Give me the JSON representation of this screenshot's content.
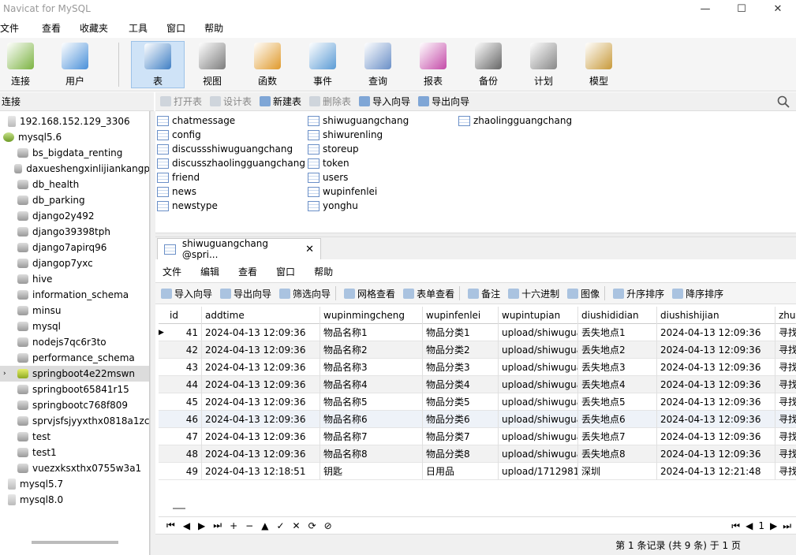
{
  "window": {
    "title": "Navicat for MySQL",
    "controls": [
      "—",
      "☐",
      "✕"
    ]
  },
  "menu": [
    "文件",
    "查看",
    "收藏夹",
    "工具",
    "窗口",
    "帮助"
  ],
  "toolbar": [
    {
      "label": "连接",
      "icon": "connection-icon"
    },
    {
      "label": "用户",
      "icon": "user-icon"
    },
    {
      "label": "表",
      "icon": "table-icon",
      "active": true
    },
    {
      "label": "视图",
      "icon": "view-icon"
    },
    {
      "label": "函数",
      "icon": "function-icon"
    },
    {
      "label": "事件",
      "icon": "event-icon"
    },
    {
      "label": "查询",
      "icon": "query-icon"
    },
    {
      "label": "报表",
      "icon": "report-icon"
    },
    {
      "label": "备份",
      "icon": "backup-icon"
    },
    {
      "label": "计划",
      "icon": "schedule-icon"
    },
    {
      "label": "模型",
      "icon": "model-icon"
    }
  ],
  "left": {
    "header": "连接",
    "tree": [
      {
        "label": "192.168.152.129_3306",
        "type": "server",
        "level": 0
      },
      {
        "label": "mysql5.6",
        "type": "conn",
        "level": 0
      },
      {
        "label": "bs_bigdata_renting",
        "type": "db",
        "level": 1
      },
      {
        "label": "daxueshengxinlijiankangp",
        "type": "db",
        "level": 1
      },
      {
        "label": "db_health",
        "type": "db",
        "level": 1
      },
      {
        "label": "db_parking",
        "type": "db",
        "level": 1
      },
      {
        "label": "django2y492",
        "type": "db",
        "level": 1
      },
      {
        "label": "django39398tph",
        "type": "db",
        "level": 1
      },
      {
        "label": "django7apirq96",
        "type": "db",
        "level": 1
      },
      {
        "label": "djangop7yxc",
        "type": "db",
        "level": 1
      },
      {
        "label": "hive",
        "type": "db",
        "level": 1
      },
      {
        "label": "information_schema",
        "type": "db",
        "level": 1
      },
      {
        "label": "minsu",
        "type": "db",
        "level": 1
      },
      {
        "label": "mysql",
        "type": "db",
        "level": 1
      },
      {
        "label": "nodejs7qc6r3to",
        "type": "db",
        "level": 1
      },
      {
        "label": "performance_schema",
        "type": "db",
        "level": 1
      },
      {
        "label": "springboot4e22mswn",
        "type": "dbopen",
        "level": 1,
        "selected": true
      },
      {
        "label": "springboot65841r15",
        "type": "db",
        "level": 1
      },
      {
        "label": "springbootc768f809",
        "type": "db",
        "level": 1
      },
      {
        "label": "sprvjsfsjyyxthx0818a1zc",
        "type": "db",
        "level": 1
      },
      {
        "label": "test",
        "type": "db",
        "level": 1
      },
      {
        "label": "test1",
        "type": "db",
        "level": 1
      },
      {
        "label": "vuezxksxthx0755w3a1",
        "type": "db",
        "level": 1
      },
      {
        "label": "mysql5.7",
        "type": "server",
        "level": 0
      },
      {
        "label": "mysql8.0",
        "type": "server",
        "level": 0
      }
    ]
  },
  "objbar": [
    {
      "label": "打开表",
      "dim": true,
      "icon": "open-table-icon"
    },
    {
      "label": "设计表",
      "dim": true,
      "icon": "design-table-icon"
    },
    {
      "label": "新建表",
      "dim": false,
      "icon": "new-table-icon"
    },
    {
      "label": "删除表",
      "dim": true,
      "icon": "delete-table-icon"
    },
    {
      "label": "导入向导",
      "dim": false,
      "icon": "import-wizard-icon"
    },
    {
      "label": "导出向导",
      "dim": false,
      "icon": "export-wizard-icon"
    }
  ],
  "tables": [
    [
      "chatmessage",
      "config",
      "discussshiwuguangchang",
      "discusszhaolingguangchang",
      "friend",
      "news",
      "newstype"
    ],
    [
      "shiwuguangchang",
      "shiwurenling",
      "storeup",
      "token",
      "users",
      "wupinfenlei",
      "yonghu"
    ],
    [
      "zhaolingguangchang"
    ]
  ],
  "tab": {
    "label": "shiwuguangchang @spri...",
    "close": "✕"
  },
  "innermenu": [
    "文件",
    "编辑",
    "查看",
    "窗口",
    "帮助"
  ],
  "innerbar": [
    "导入向导",
    "导出向导",
    "筛选向导",
    "|",
    "网格查看",
    "表单查看",
    "|",
    "备注",
    "十六进制",
    "图像",
    "|",
    "升序排序",
    "降序排序"
  ],
  "grid": {
    "columns": [
      "id",
      "addtime",
      "wupinmingcheng",
      "wupinfenlei",
      "wupintupian",
      "diushididian",
      "diushishijian",
      "zhua"
    ],
    "rows": [
      [
        "41",
        "2024-04-13 12:09:36",
        "物品名称1",
        "物品分类1",
        "upload/shiwugua",
        "丢失地点1",
        "2024-04-13 12:09:36",
        "寻找"
      ],
      [
        "42",
        "2024-04-13 12:09:36",
        "物品名称2",
        "物品分类2",
        "upload/shiwugua",
        "丢失地点2",
        "2024-04-13 12:09:36",
        "寻找"
      ],
      [
        "43",
        "2024-04-13 12:09:36",
        "物品名称3",
        "物品分类3",
        "upload/shiwugua",
        "丢失地点3",
        "2024-04-13 12:09:36",
        "寻找"
      ],
      [
        "44",
        "2024-04-13 12:09:36",
        "物品名称4",
        "物品分类4",
        "upload/shiwugua",
        "丢失地点4",
        "2024-04-13 12:09:36",
        "寻找"
      ],
      [
        "45",
        "2024-04-13 12:09:36",
        "物品名称5",
        "物品分类5",
        "upload/shiwugua",
        "丢失地点5",
        "2024-04-13 12:09:36",
        "寻找"
      ],
      [
        "46",
        "2024-04-13 12:09:36",
        "物品名称6",
        "物品分类6",
        "upload/shiwugua",
        "丢失地点6",
        "2024-04-13 12:09:36",
        "寻找"
      ],
      [
        "47",
        "2024-04-13 12:09:36",
        "物品名称7",
        "物品分类7",
        "upload/shiwugua",
        "丢失地点7",
        "2024-04-13 12:09:36",
        "寻找"
      ],
      [
        "48",
        "2024-04-13 12:09:36",
        "物品名称8",
        "物品分类8",
        "upload/shiwugua",
        "丢失地点8",
        "2024-04-13 12:09:36",
        "寻找"
      ],
      [
        "49",
        "2024-04-13 12:18:51",
        "钥匙",
        "日用品",
        "upload/1712981",
        "深圳",
        "2024-04-13 12:21:48",
        "寻找"
      ]
    ]
  },
  "nav": [
    "⏮",
    "◀",
    "▶",
    "⏭",
    "+",
    "−",
    "▲",
    "✓",
    "✕",
    "⟳",
    "⊘"
  ],
  "pager": {
    "first": "⏮",
    "prev": "◀",
    "page": "1",
    "next": "▶",
    "last": "⏭"
  },
  "status": "第 1 条记录 (共 9 条) 于 1 页"
}
